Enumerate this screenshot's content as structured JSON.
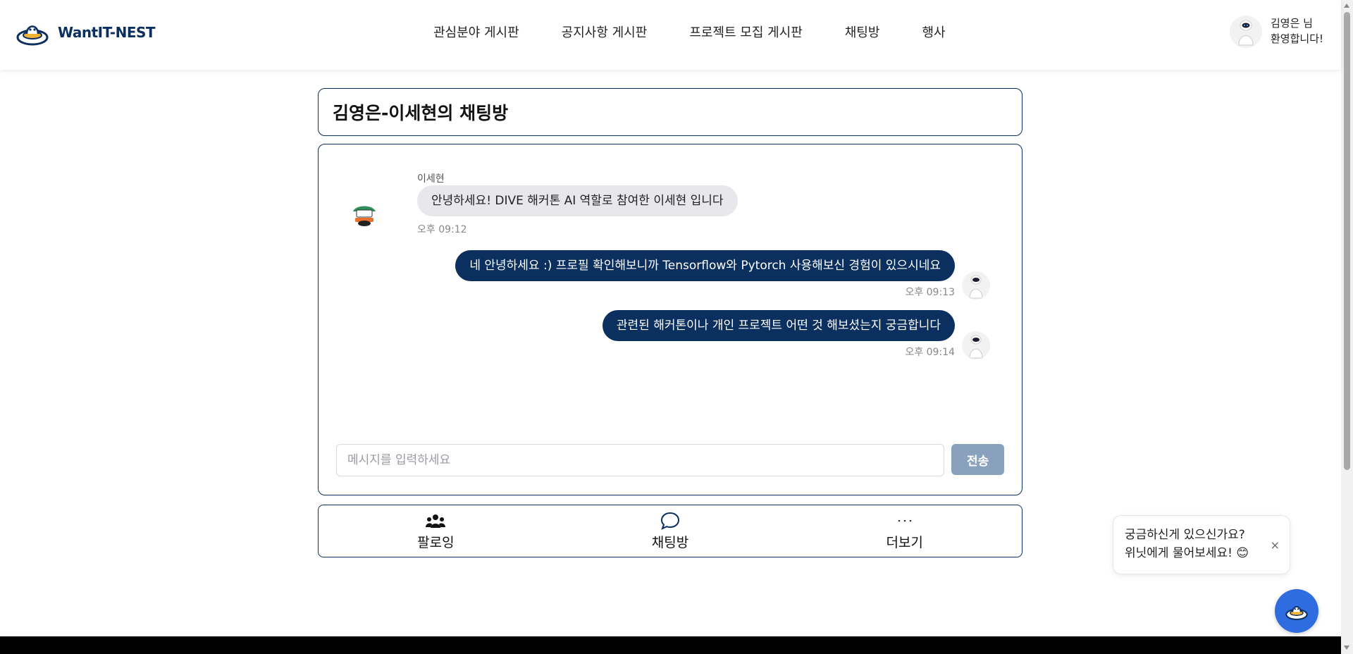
{
  "header": {
    "logo_text": "WantIT-NEST",
    "nav": [
      {
        "label": "관심분야 게시판"
      },
      {
        "label": "공지사항 게시판"
      },
      {
        "label": "프로젝트 모집 게시판"
      },
      {
        "label": "채팅방"
      },
      {
        "label": "행사"
      }
    ],
    "user_line1": "김영은 님",
    "user_line2": "환영합니다!"
  },
  "chat": {
    "title": "김영은-이세현의 채팅방",
    "messages": [
      {
        "sender": "이세현",
        "text": "안녕하세요! DIVE 해커톤 AI 역할로 참여한 이세현 입니다",
        "time": "오후 09:12"
      },
      {
        "text": "네 안녕하세요 :) 프로필 확인해보니까 Tensorflow와 Pytorch 사용해보신 경험이 있으시네요",
        "time": "오후 09:13"
      },
      {
        "text": "관련된 해커톤이나 개인 프로젝트 어떤 것 해보셨는지 궁금합니다",
        "time": "오후 09:14"
      }
    ],
    "input_placeholder": "메시지를 입력하세요",
    "send_label": "전송"
  },
  "bottom_nav": [
    {
      "label": "팔로잉",
      "icon": "users-icon"
    },
    {
      "label": "채팅방",
      "icon": "chat-bubble-icon"
    },
    {
      "label": "더보기",
      "icon": "more-icon"
    }
  ],
  "widget": {
    "line1": "궁금하신게 있으신가요?",
    "line2": "위닛에게 물어보세요! 😊",
    "close": "×"
  },
  "colors": {
    "primary": "#0b2f5e",
    "bubble_other": "#e8e8ec",
    "send_button": "#8aa1bd",
    "fab": "#2f6ce0"
  }
}
